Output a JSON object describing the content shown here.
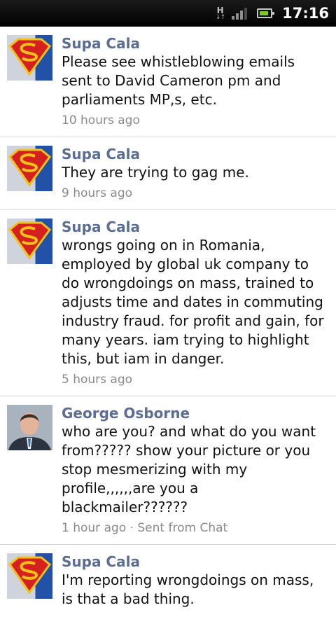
{
  "status_bar": {
    "network_type": "H",
    "time": "17:16"
  },
  "messages": [
    {
      "author": "Supa Cala",
      "avatar": "superman-logo-avatar",
      "text": "Please see whistleblowing emails sent to David Cameron pm and parliaments MP,s, etc.",
      "meta": "10 hours ago"
    },
    {
      "author": "Supa Cala",
      "avatar": "superman-logo-avatar",
      "text": "They are trying to gag me.",
      "meta": "9 hours ago"
    },
    {
      "author": "Supa Cala",
      "avatar": "superman-logo-avatar",
      "text": "wrongs going on in Romania, employed by global uk company to do wrongdoings on mass, trained to adjusts time and dates in commuting industry fraud. for profit and gain, for many years. iam trying to highlight this, but iam in danger.",
      "meta": "5 hours ago"
    },
    {
      "author": "George Osborne",
      "avatar": "person-photo-avatar",
      "text": "who are you? and what do you want from????? show your picture or you stop mesmerizing with my profile,,,,,,are you a blackmailer??????",
      "meta": "1 hour ago · Sent from Chat"
    },
    {
      "author": "Supa Cala",
      "avatar": "superman-logo-avatar",
      "text": "I'm reporting wrongdoings on mass, is that a bad thing.",
      "meta": ""
    }
  ]
}
